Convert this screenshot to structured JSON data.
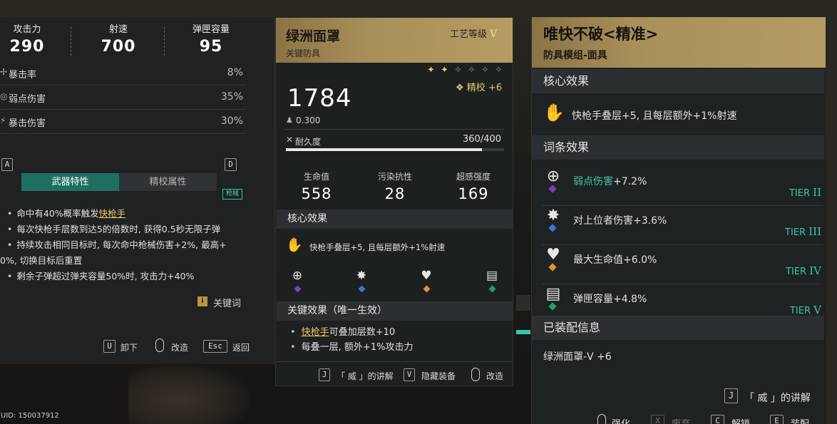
{
  "colors": {
    "gold": "#e7c766",
    "teal": "#36c6a9",
    "tab_active": "#1f6f61"
  },
  "weapon": {
    "stats": [
      {
        "label": "攻击力",
        "value": "290"
      },
      {
        "label": "射速",
        "value": "700"
      },
      {
        "label": "弹匣容量",
        "value": "95"
      }
    ],
    "subs": [
      {
        "label": "暴击率",
        "value": "8%"
      },
      {
        "label": "弱点伤害",
        "value": "35%"
      },
      {
        "label": "暴击伤害",
        "value": "30%"
      }
    ],
    "tab_key_left": "A",
    "tab_key_right": "D",
    "tabs": {
      "traits": "武器特性",
      "tuning": "精校属性"
    },
    "trait_tag": "枪械",
    "traits": {
      "line1_pre": "命中有40%概率触发",
      "line1_link": "快枪手",
      "line2": "每次快枪手层数到达5的倍数时, 获得0.5秒无限子弹",
      "line3": "持续攻击相同目标时, 每次命中枪械伤害+2%, 最高+",
      "line4": "0%, 切换目标后重置",
      "line5": "剩余子弹超过弹夹容量50%时, 攻击力+40%"
    },
    "keyword_label": "关键词",
    "hints": {
      "unequip_key": "U",
      "unequip": "卸下",
      "modify": "改造",
      "back_key": "Esc",
      "back": "返回"
    },
    "uid": "UID: 150037912"
  },
  "armor": {
    "name": "绿洲面罩",
    "type": "关键防具",
    "craft_label": "工艺等级",
    "craft_level": "V",
    "stars_filled": 2,
    "stars_total": 6,
    "tune_label": "精校 +6",
    "score": "1784",
    "weight": "0.300",
    "durability_label": "耐久度",
    "durability_text": "360/400",
    "durability": 0.9,
    "stats": [
      {
        "label": "生命值",
        "value": "558"
      },
      {
        "label": "污染抗性",
        "value": "28"
      },
      {
        "label": "超感强度",
        "value": "169"
      }
    ],
    "core_title": "核心效果",
    "core_effect": "快枪手叠层+5, 且每层额外+1%射速",
    "key_title": "关键效果（唯一生效）",
    "key_line1_link": "快枪手",
    "key_line1_rest": "可叠加层数+10",
    "key_line2": "每叠一层, 额外+1%攻击力",
    "hints": {
      "explain_key": "J",
      "explain": "「 威 」的讲解",
      "hide_key": "V",
      "hide": "隐藏装备",
      "modify": "改造"
    }
  },
  "mod": {
    "name": "唯快不破<精准>",
    "type": "防具模组-面具",
    "core_title": "核心效果",
    "core_effect": "快枪手叠层+5, 且每层额外+1%射速",
    "affix_title": "词条效果",
    "affixes": [
      {
        "text_hl": "弱点伤害",
        "text": "+7.2%",
        "tier": "TIER",
        "tier_rn": "II"
      },
      {
        "text_hl": "",
        "text": "对上位者伤害+3.6%",
        "tier": "TIER",
        "tier_rn": "III"
      },
      {
        "text_hl": "",
        "text": "最大生命值+6.0%",
        "tier": "TIER",
        "tier_rn": "IV"
      },
      {
        "text_hl": "",
        "text": "弹匣容量+4.8%",
        "tier": "TIER",
        "tier_rn": "V"
      }
    ],
    "equipped_title": "已装配信息",
    "equipped_value": "绿洲面罩-V +6",
    "hints": {
      "explain_key": "J",
      "explain": "「 威 」的讲解",
      "enhance": "强化",
      "dismantle_key": "X",
      "dismantle": "废弃",
      "unlock_key": "C",
      "unlock": "解锁",
      "equip_key": "E",
      "equip": "装配"
    }
  }
}
